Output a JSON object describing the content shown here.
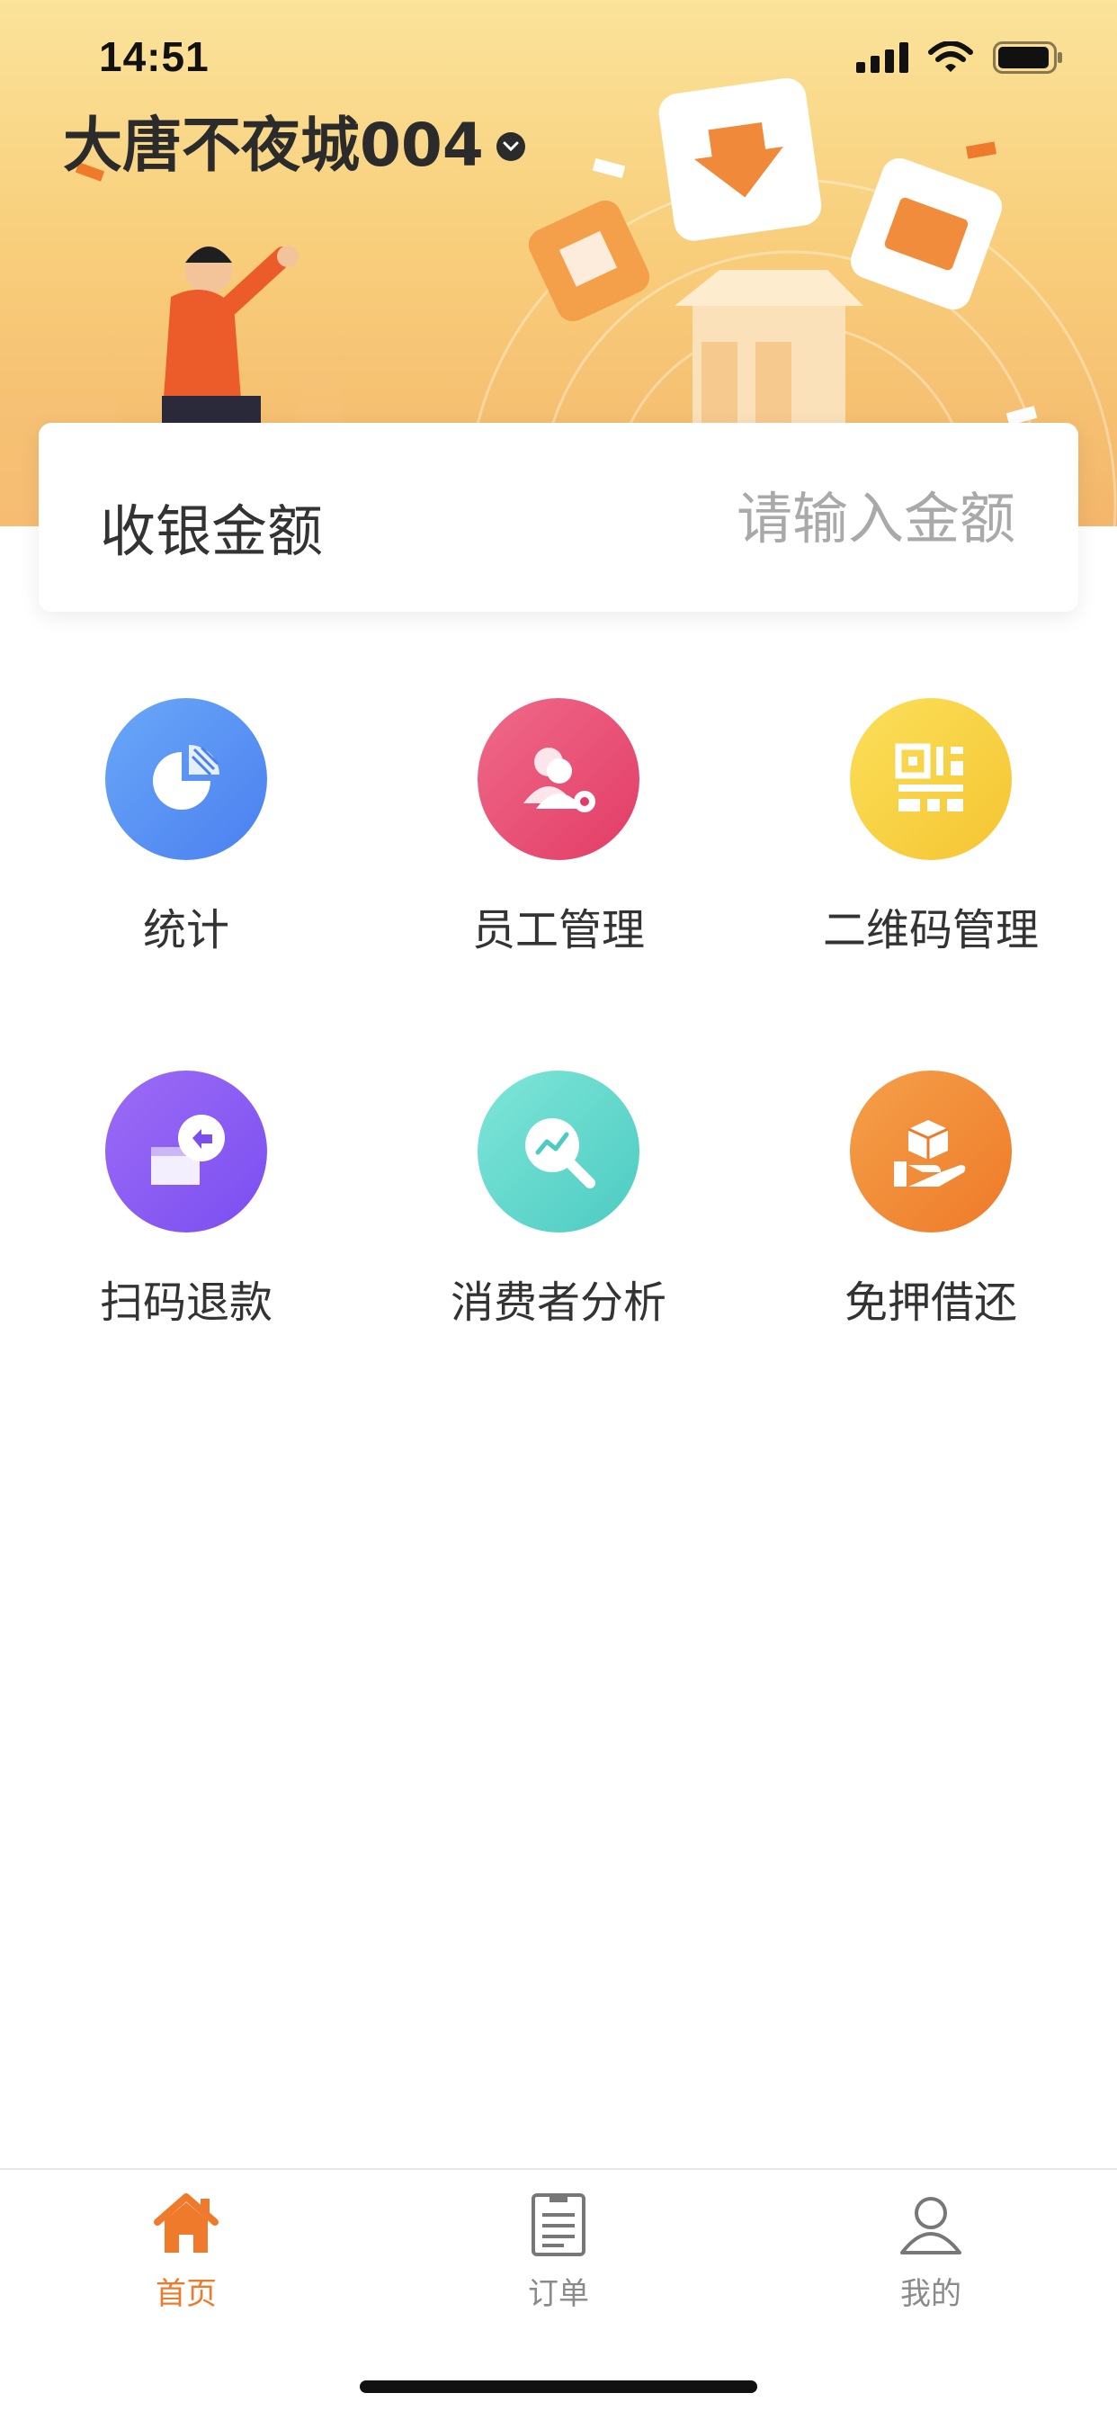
{
  "status_bar": {
    "time": "14:51"
  },
  "header": {
    "store_name": "大唐不夜城004"
  },
  "amount": {
    "label": "收银金额",
    "placeholder": "请输入金额",
    "value": ""
  },
  "menu": [
    {
      "label": "统计",
      "icon": "pie-chart-icon",
      "color_from": "#6aa8f8",
      "color_to": "#4a7ff0"
    },
    {
      "label": "员工管理",
      "icon": "staff-settings-icon",
      "color_from": "#f06a8a",
      "color_to": "#e23c66"
    },
    {
      "label": "二维码管理",
      "icon": "qr-code-icon",
      "color_from": "#fbe05a",
      "color_to": "#f5c431"
    },
    {
      "label": "扫码退款",
      "icon": "refund-icon",
      "color_from": "#9c6cf6",
      "color_to": "#7b4ef0"
    },
    {
      "label": "消费者分析",
      "icon": "analysis-search-icon",
      "color_from": "#7fe6d8",
      "color_to": "#4ccbc2"
    },
    {
      "label": "免押借还",
      "icon": "box-hand-icon",
      "color_from": "#f5a04a",
      "color_to": "#ee7a28"
    }
  ],
  "tabbar": {
    "tabs": [
      {
        "label": "首页",
        "icon": "home-icon",
        "active": true
      },
      {
        "label": "订单",
        "icon": "order-list-icon",
        "active": false
      },
      {
        "label": "我的",
        "icon": "user-icon",
        "active": false
      }
    ],
    "active_color": "#f07a2b",
    "inactive_color": "#8a8a8a"
  }
}
